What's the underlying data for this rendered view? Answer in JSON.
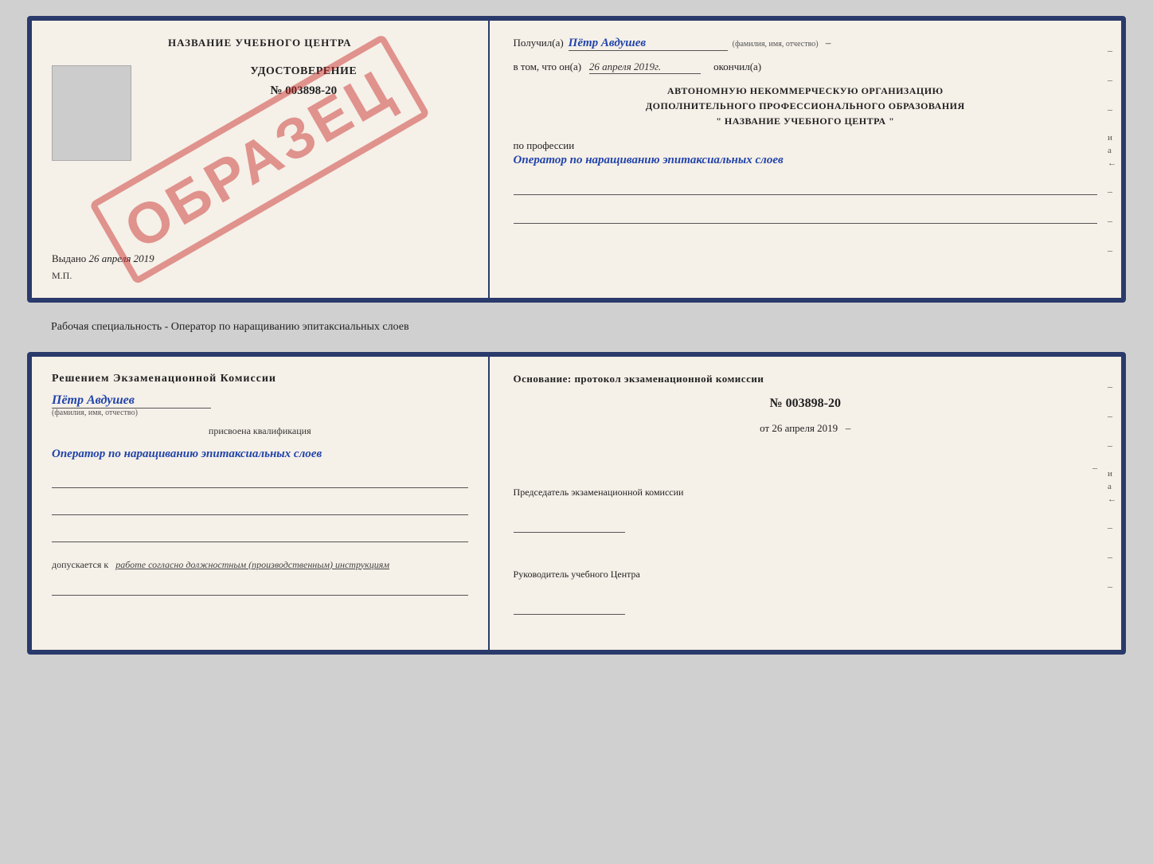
{
  "background_color": "#d0d0d0",
  "cert1": {
    "left": {
      "training_center_label": "НАЗВАНИЕ УЧЕБНОГО ЦЕНТРА",
      "stamp_text": "ОБРАЗЕЦ",
      "doc_title": "УДОСТОВЕРЕНИЕ",
      "doc_number": "№ 003898-20",
      "issued_label": "Выдано",
      "issued_date": "26 апреля 2019",
      "mp_label": "М.П."
    },
    "right": {
      "received_prefix": "Получил(а)",
      "recipient_name": "Пётр Авдушев",
      "recipient_sublabel": "(фамилия, имя, отчество)",
      "date_prefix": "в том, что он(а)",
      "date_value": "26 апреля 2019г.",
      "finished_suffix": "окончил(а)",
      "org_line1": "АВТОНОМНУЮ НЕКОММЕРЧЕСКУЮ ОРГАНИЗАЦИЮ",
      "org_line2": "ДОПОЛНИТЕЛЬНОГО ПРОФЕССИОНАЛЬНОГО ОБРАЗОВАНИЯ",
      "org_line3": "\"  НАЗВАНИЕ УЧЕБНОГО ЦЕНТРА  \"",
      "profession_prefix": "по профессии",
      "profession_value": "Оператор по наращиванию эпитаксиальных слоев",
      "side_dashes": [
        "–",
        "–",
        "–",
        "и",
        "а",
        "←",
        "–",
        "–",
        "–"
      ]
    }
  },
  "specialty_label": "Рабочая специальность - Оператор по наращиванию эпитаксиальных слоев",
  "cert2": {
    "left": {
      "commission_title": "Решением  экзаменационной  комиссии",
      "person_name": "Пётр Авдушев",
      "person_sublabel": "(фамилия, имя, отчество)",
      "assigned_label": "присвоена квалификация",
      "profession_value": "Оператор по наращиванию эпитаксиальных слоев",
      "underlines": [
        "",
        "",
        ""
      ],
      "admitted_prefix": "допускается к",
      "admitted_value": "работе согласно должностным (производственным) инструкциям"
    },
    "right": {
      "basis_title": "Основание: протокол экзаменационной  комиссии",
      "proto_number": "№  003898-20",
      "proto_date_prefix": "от",
      "proto_date": "26 апреля 2019",
      "chairman_title": "Председатель экзаменационной комиссии",
      "director_title": "Руководитель учебного Центра",
      "side_dashes": [
        "–",
        "–",
        "–",
        "и",
        "а",
        "←",
        "–",
        "–",
        "–"
      ]
    }
  }
}
